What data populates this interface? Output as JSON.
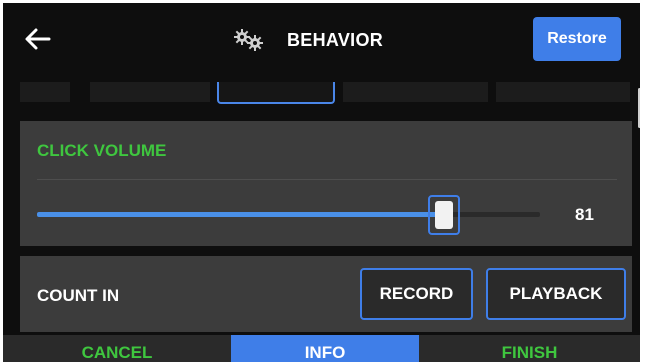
{
  "header": {
    "back_icon": "arrow-left-icon",
    "title_icon": "gears-icon",
    "title": "BEHAVIOR",
    "restore_label": "Restore"
  },
  "volume": {
    "label": "CLICK VOLUME",
    "value": "81",
    "level_percent": 81,
    "accent_color": "#3fc63f",
    "slider_color": "#4a90e8"
  },
  "count_in": {
    "label": "COUNT IN",
    "record_label": "RECORD",
    "playback_label": "PLAYBACK"
  },
  "footer": {
    "cancel_label": "CANCEL",
    "info_label": "INFO",
    "finish_label": "FINISH"
  },
  "colors": {
    "primary_blue": "#3f7ee8",
    "green": "#3fc63f",
    "background": "#0e0e0e",
    "panel": "#3c3c3c"
  }
}
